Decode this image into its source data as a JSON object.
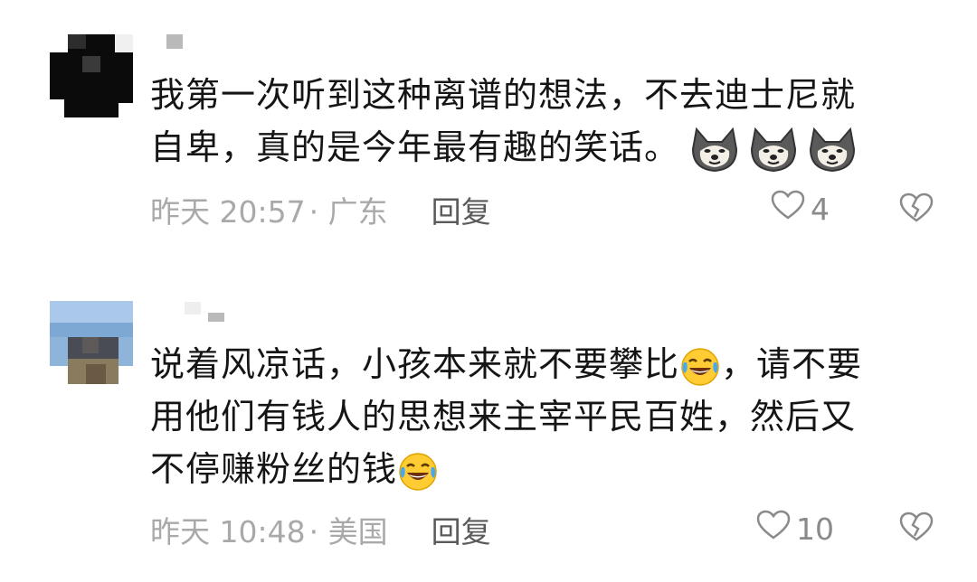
{
  "comments": [
    {
      "text_line1": "我第一次听到这种离谱的想法，不去迪士尼就",
      "text_line2": "自卑，真的是今年最有趣的笑话。",
      "emoji": "doge-icon",
      "time": "昨天 20:57",
      "location": "· 广东",
      "reply": "回复",
      "likes": "4"
    },
    {
      "text_line1a": "说着风凉话，小孩本来就不要攀比",
      "text_line1b": "，请不要",
      "text_line2": "用他们有钱人的思想来主宰平民百姓，然后又",
      "text_line3": "不停赚粉丝的钱",
      "emoji": "laugh-cry-icon",
      "time": "昨天 10:48",
      "location": "· 美国",
      "reply": "回复",
      "likes": "10"
    }
  ],
  "colors": {
    "text": "#151515",
    "meta": "#a9a9a9",
    "reply": "#5a5a5a",
    "icon": "#8a8a8a"
  }
}
